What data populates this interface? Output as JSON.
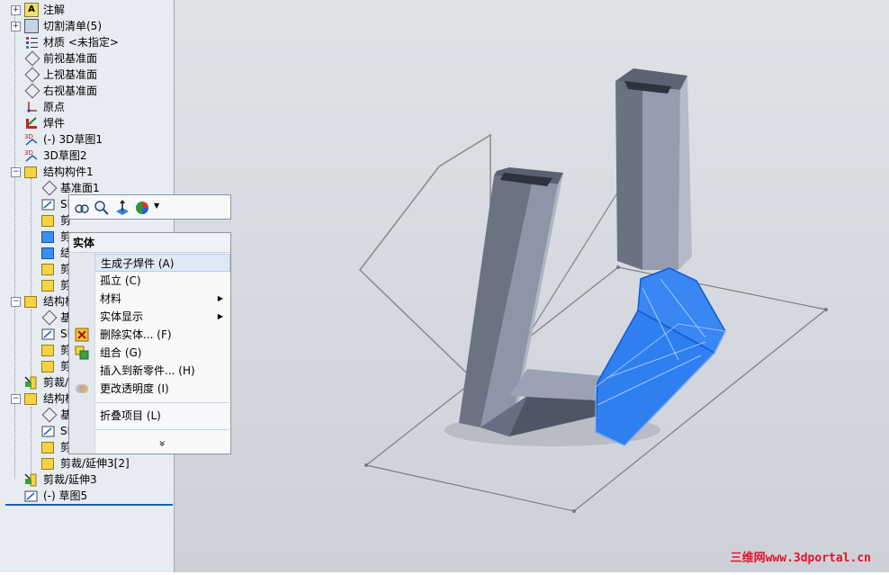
{
  "tree": {
    "items": [
      {
        "label": "注解",
        "expander": "+"
      },
      {
        "label": "切割清单(5)",
        "expander": "+"
      },
      {
        "label": "材质 <未指定>"
      },
      {
        "label": "前视基准面"
      },
      {
        "label": "上视基准面"
      },
      {
        "label": "右视基准面"
      },
      {
        "label": "原点"
      },
      {
        "label": "焊件"
      },
      {
        "label": "(-) 3D草图1"
      },
      {
        "label": "3D草图2"
      },
      {
        "label": "结构构件1",
        "expander": "−"
      },
      {
        "label": "基准面1"
      },
      {
        "label": "Sl"
      },
      {
        "label": "剪"
      },
      {
        "label": "剪"
      },
      {
        "label": "结"
      },
      {
        "label": "剪"
      },
      {
        "label": "剪"
      },
      {
        "label": "结构构",
        "expander": "−"
      },
      {
        "label": "基"
      },
      {
        "label": "Sl"
      },
      {
        "label": "剪"
      },
      {
        "label": "剪"
      },
      {
        "label": "剪裁/"
      },
      {
        "label": "结构构",
        "expander": "−"
      },
      {
        "label": "基"
      },
      {
        "label": "Sl"
      },
      {
        "label": "剪"
      },
      {
        "label": "剪"
      },
      {
        "label": "剪裁/延伸3[2]"
      },
      {
        "label": "剪裁/延伸3"
      },
      {
        "label": "(-) 草图5"
      }
    ]
  },
  "context_menu": {
    "title": "实体",
    "items": [
      {
        "label": "生成子焊件 (A)"
      },
      {
        "label": "孤立 (C)"
      },
      {
        "label": "材料"
      },
      {
        "label": "实体显示"
      },
      {
        "label": "删除实体... (F)"
      },
      {
        "label": "组合 (G)"
      },
      {
        "label": "插入到新零件... (H)"
      },
      {
        "label": "更改透明度 (I)"
      },
      {
        "label": "折叠项目 (L)"
      }
    ],
    "more": "»"
  },
  "watermark": "三维网www.3dportal.cn",
  "colors": {
    "selection_blue": "#2f7ff0",
    "tube_dark": "#4a5060",
    "tube_light": "#9aa2b4",
    "panel_bg": "#e7ecf2"
  }
}
